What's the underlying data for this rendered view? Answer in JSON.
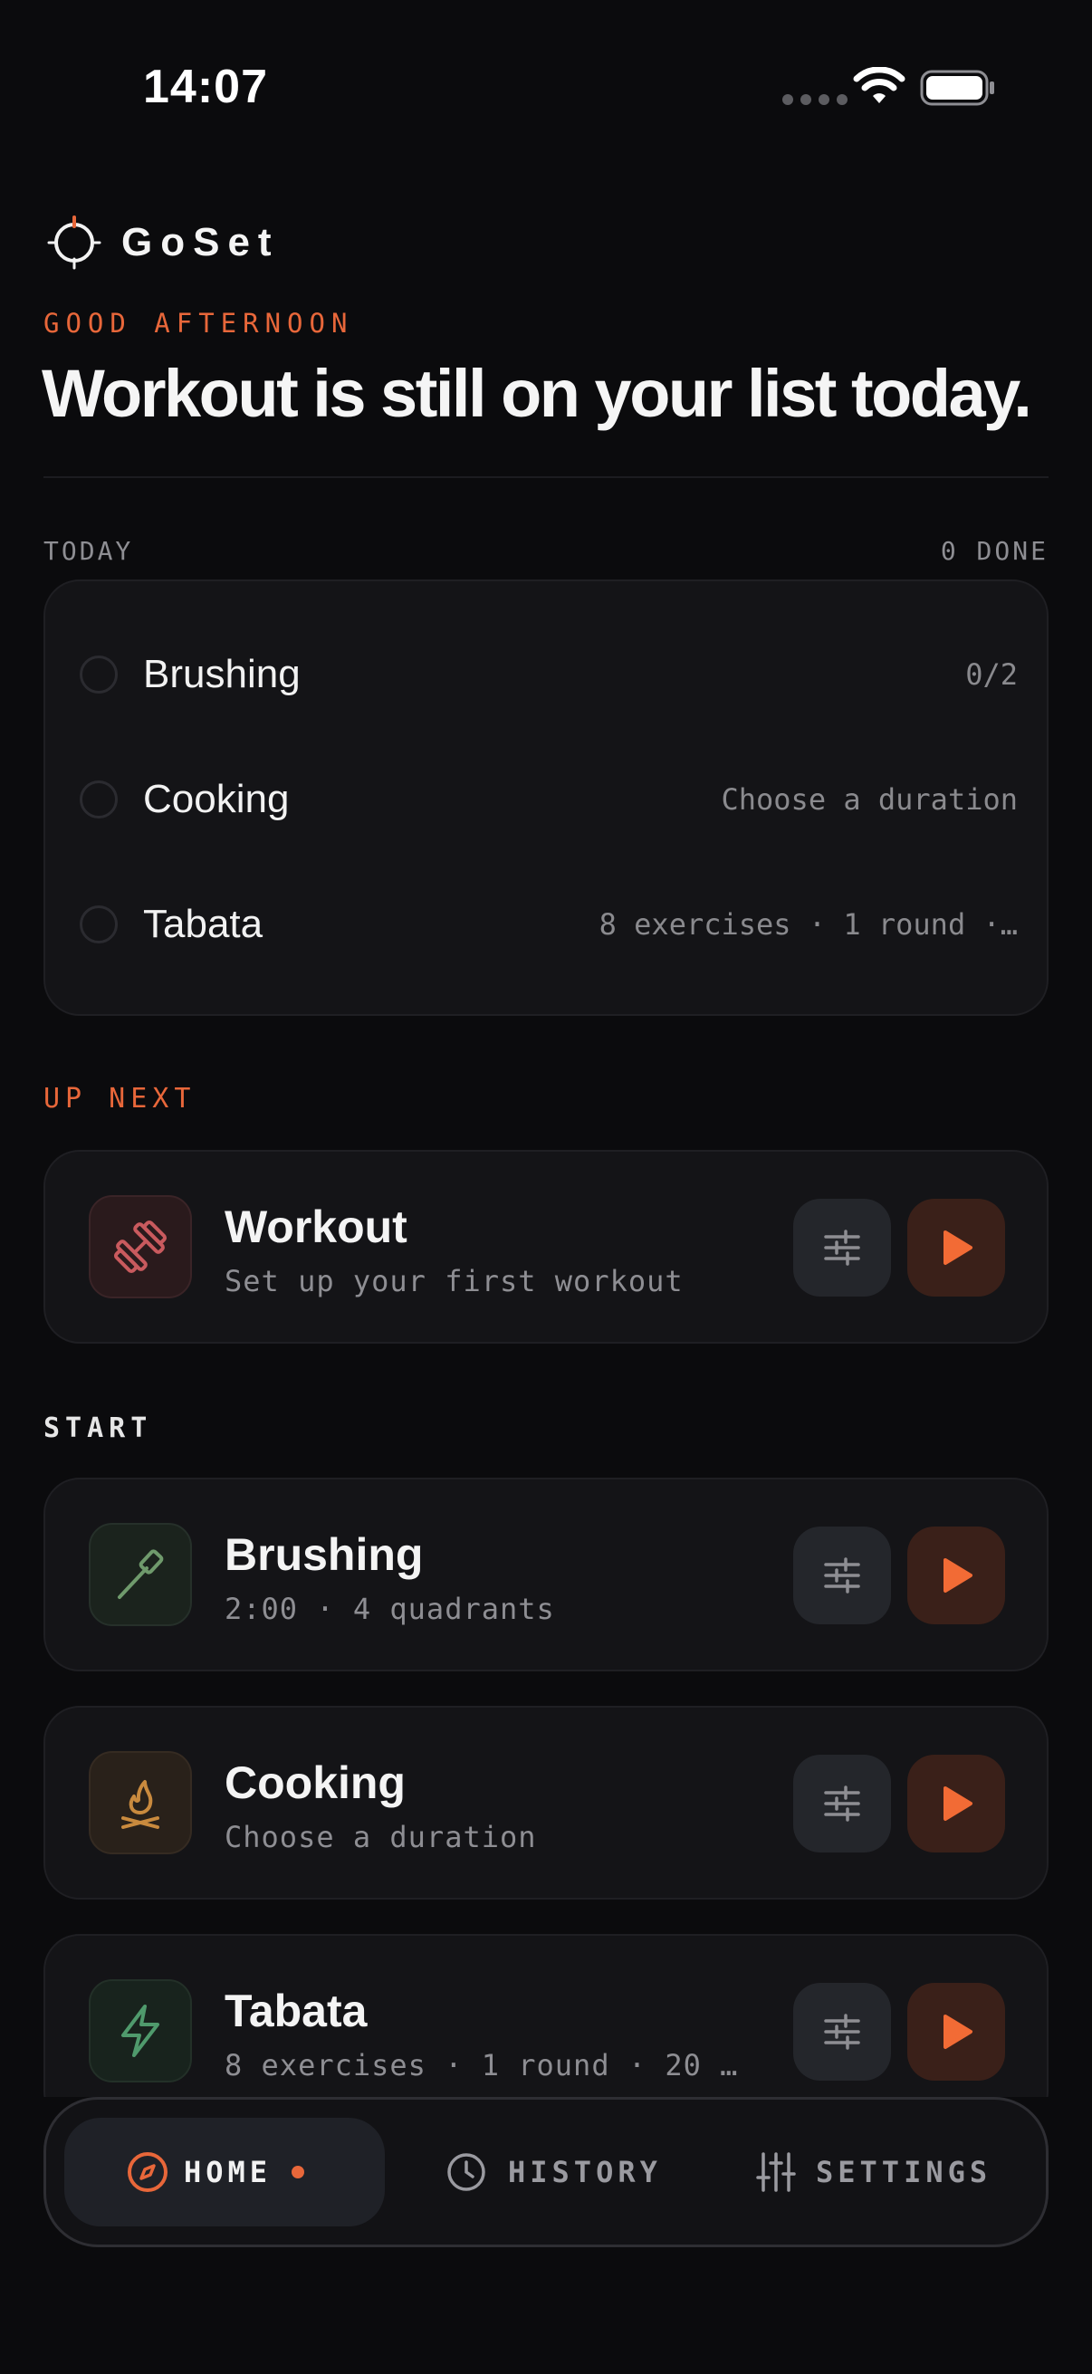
{
  "status_bar": {
    "time": "14:07"
  },
  "brand": {
    "name": "GoSet"
  },
  "greeting": "GOOD AFTERNOON",
  "headline": "Workout is still on your list today.",
  "today": {
    "label": "TODAY",
    "done_count": "0 DONE",
    "items": [
      {
        "name": "Brushing",
        "meta": "0/2"
      },
      {
        "name": "Cooking",
        "meta": "Choose a duration"
      },
      {
        "name": "Tabata",
        "meta": "8 exercises · 1 round ·…"
      }
    ]
  },
  "up_next": {
    "label": "UP NEXT",
    "card": {
      "title": "Workout",
      "subtitle": "Set up your first workout",
      "icon": "dumbbell-icon"
    }
  },
  "start": {
    "label": "START",
    "cards": [
      {
        "title": "Brushing",
        "subtitle": "2:00 · 4 quadrants",
        "icon": "toothbrush-icon"
      },
      {
        "title": "Cooking",
        "subtitle": "Choose a duration",
        "icon": "flame-icon"
      },
      {
        "title": "Tabata",
        "subtitle": "8 exercises · 1 round · 20 s…",
        "icon": "lightning-icon"
      }
    ]
  },
  "nav": {
    "home": "HOME",
    "history": "HISTORY",
    "settings": "SETTINGS"
  },
  "colors": {
    "accent": "#e8673a",
    "background": "#0b0b0d",
    "card": "#141417"
  }
}
